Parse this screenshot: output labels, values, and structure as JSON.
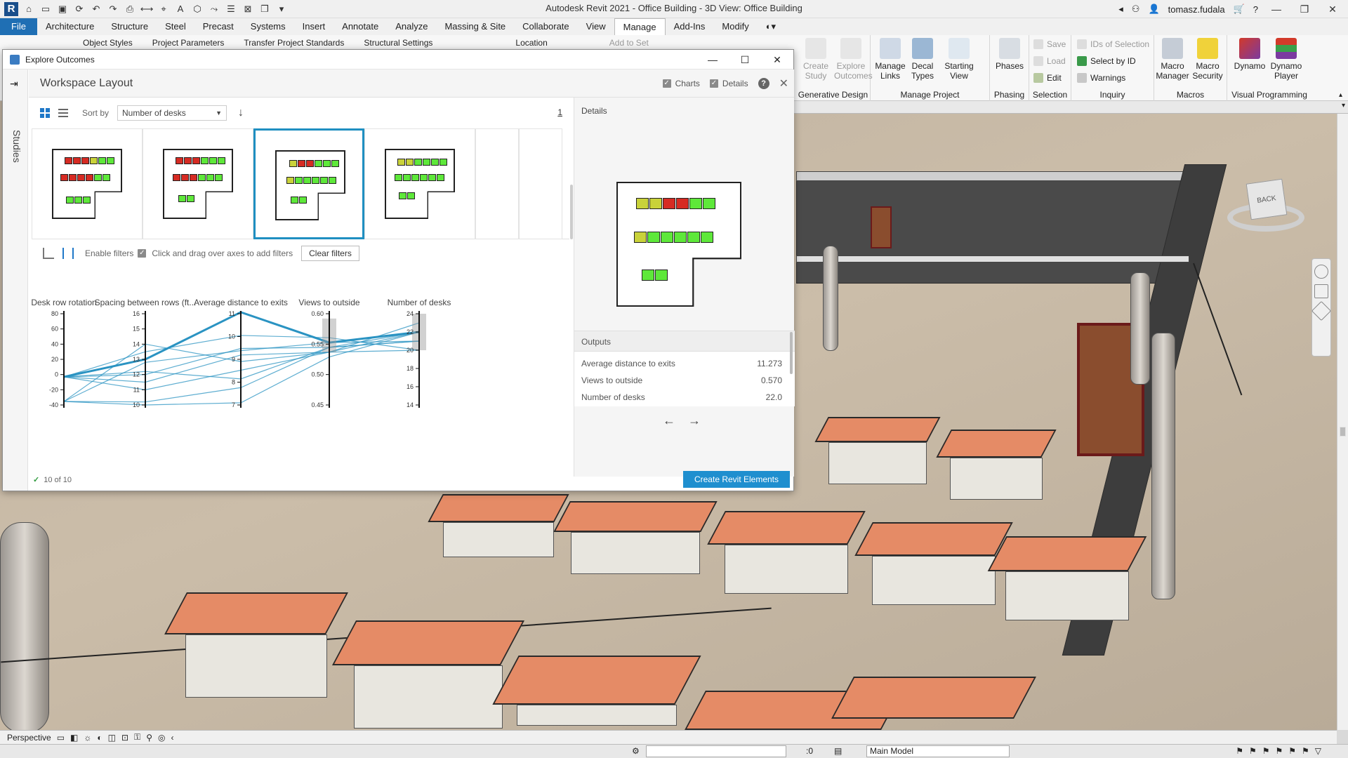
{
  "app": {
    "title": "Autodesk Revit 2021 - Office Building - 3D View: Office Building",
    "user": "tomasz.fudala",
    "logo": "R"
  },
  "tabs": [
    "File",
    "Architecture",
    "Structure",
    "Steel",
    "Precast",
    "Systems",
    "Insert",
    "Annotate",
    "Analyze",
    "Massing & Site",
    "Collaborate",
    "View",
    "Manage",
    "Add-Ins",
    "Modify"
  ],
  "active_tab": "Manage",
  "ribbon": {
    "hidden_row": [
      "Object Styles",
      "Project Parameters",
      "Transfer Project Standards",
      "Structural Settings",
      "Location",
      "Add to Set"
    ],
    "generative_design": {
      "label": "Generative Design",
      "create_study": "Create Study",
      "explore_outcomes": "Explore Outcomes"
    },
    "manage_project": {
      "label": "Manage Project",
      "manage_links": "Manage Links",
      "decal_types": "Decal Types",
      "starting_view": "Starting View"
    },
    "phasing": {
      "label": "Phasing",
      "phases": "Phases"
    },
    "selection": {
      "label": "Selection",
      "save": "Save",
      "load": "Load",
      "edit": "Edit"
    },
    "inquiry": {
      "label": "Inquiry",
      "ids_of_selection": "IDs of Selection",
      "select_by_id": "Select by ID",
      "warnings": "Warnings"
    },
    "macros": {
      "label": "Macros",
      "macro_manager": "Macro Manager",
      "macro_security": "Macro Security"
    },
    "visual_programming": {
      "label": "Visual Programming",
      "dynamo": "Dynamo",
      "dynamo_player": "Dynamo Player"
    }
  },
  "dialog": {
    "title": "Explore Outcomes",
    "rail_label": "Studies",
    "workspace_title": "Workspace Layout",
    "charts_label": "Charts",
    "details_label": "Details",
    "sort_by_label": "Sort by",
    "sort_value": "Number of desks",
    "page": "1",
    "enable_filters": "Enable filters",
    "drag_hint": "Click and drag over axes to add filters",
    "clear_filters": "Clear filters",
    "details_title": "Details",
    "outputs_label": "Outputs",
    "outputs": [
      {
        "name": "Average distance to exits",
        "value": "11.273"
      },
      {
        "name": "Views to outside",
        "value": "0.570"
      },
      {
        "name": "Number of desks",
        "value": "22.0"
      }
    ],
    "count": "10 of 10",
    "create_button": "Create Revit Elements"
  },
  "chart_data": {
    "type": "parallel-coordinates",
    "axes": [
      {
        "name": "Desk row rotation",
        "ticks": [
          "80",
          "60",
          "40",
          "20",
          "0",
          "-20",
          "-40"
        ],
        "range": [
          -45,
          85
        ]
      },
      {
        "name": "Spacing between rows (ft...",
        "ticks": [
          "16",
          "15",
          "14",
          "13",
          "12",
          "11",
          "10"
        ],
        "range": [
          10,
          16
        ]
      },
      {
        "name": "Average distance to exits",
        "ticks": [
          "11",
          "10",
          "9",
          "8",
          "7"
        ],
        "range": [
          7,
          11.2
        ]
      },
      {
        "name": "Views to outside",
        "ticks": [
          "0.60",
          "0.55",
          "0.50",
          "0.45"
        ],
        "range": [
          0.44,
          0.63
        ]
      },
      {
        "name": "Number of desks",
        "ticks": [
          "24",
          "22",
          "20",
          "18",
          "16",
          "14"
        ],
        "range": [
          14,
          24
        ]
      }
    ],
    "selected_index": 0,
    "outcomes": [
      [
        -5,
        13,
        11.27,
        0.57,
        22
      ],
      [
        -5,
        12,
        9.6,
        0.56,
        22
      ],
      [
        -40,
        10.2,
        7.8,
        0.56,
        21
      ],
      [
        -5,
        11.5,
        9.3,
        0.55,
        23
      ],
      [
        -40,
        14,
        9.0,
        0.55,
        22
      ],
      [
        -5,
        12.2,
        8.2,
        0.56,
        21
      ],
      [
        -40,
        12.8,
        9.5,
        0.57,
        21
      ],
      [
        -5,
        11,
        8.6,
        0.55,
        20
      ],
      [
        -40,
        10,
        7.1,
        0.54,
        22
      ],
      [
        -5,
        13.5,
        10.2,
        0.58,
        20
      ]
    ],
    "filtered_ranges": {
      "Views to outside": [
        0.55,
        0.62
      ],
      "Number of desks": [
        20,
        24
      ]
    }
  },
  "status": {
    "view_scale": "Perspective",
    "selection_count": ":0",
    "model": "Main Model"
  },
  "colors": {
    "accent": "#1f8fcf",
    "line": "#2a93c2",
    "red_desk": "#d62b23",
    "green_desk": "#5ee83a",
    "desk_top": "#e58b66"
  }
}
